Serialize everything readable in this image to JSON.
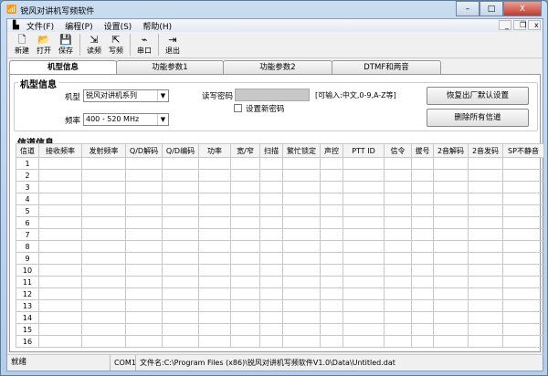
{
  "window": {
    "title": "锐风对讲机写频软件",
    "min": "–",
    "max": "□",
    "close": "X"
  },
  "menu": [
    "文件(F)",
    "编程(P)",
    "设置(S)",
    "帮助(H)"
  ],
  "mdi": [
    "_",
    "❐",
    "x"
  ],
  "toolbar": [
    {
      "label": "新建",
      "icon": "new-file-icon",
      "g": "🗋"
    },
    {
      "label": "打开",
      "icon": "open-folder-icon",
      "g": "📂"
    },
    {
      "label": "保存",
      "icon": "save-icon",
      "g": "💾"
    },
    {
      "label": "读频",
      "icon": "read-icon",
      "g": "⇲"
    },
    {
      "label": "写频",
      "icon": "write-icon",
      "g": "⇱"
    },
    {
      "label": "串口",
      "icon": "serial-port-icon",
      "g": "⌁"
    },
    {
      "label": "退出",
      "icon": "exit-icon",
      "g": "⇥"
    }
  ],
  "tabs": [
    "机型信息",
    "功能参数1",
    "功能参数2",
    "DTMF和两音"
  ],
  "model_group": {
    "title": "机型信息",
    "model_label": "机型",
    "model_value": "锐风对讲机系列",
    "freq_label": "频率",
    "freq_value": "400 - 520 MHz",
    "pwd_label": "读写密码",
    "pwd_hint": "[可输入:中文,0-9,A-Z等]",
    "new_pwd": "设置新密码",
    "restore": "恢复出厂默认设置",
    "delete_all": "删除所有信道"
  },
  "channel_group": {
    "title": "信道信息",
    "columns": [
      "信道",
      "接收频率",
      "发射频率",
      "Q/D解码",
      "Q/D编码",
      "功率",
      "宽/窄",
      "扫描",
      "繁忙锁定",
      "声控",
      "PTT ID",
      "信令",
      "拔号",
      "2音解码",
      "2音发码",
      "SP不静音"
    ],
    "rows": [
      "1",
      "2",
      "3",
      "4",
      "5",
      "6",
      "7",
      "8",
      "9",
      "10",
      "11",
      "12",
      "13",
      "14",
      "15",
      "16"
    ]
  },
  "status": {
    "state": "就绪",
    "port": "COM1",
    "file": "文件名:C:\\Program Files (x86)\\锐风对讲机写频软件V1.0\\Data\\Untitled.dat"
  }
}
